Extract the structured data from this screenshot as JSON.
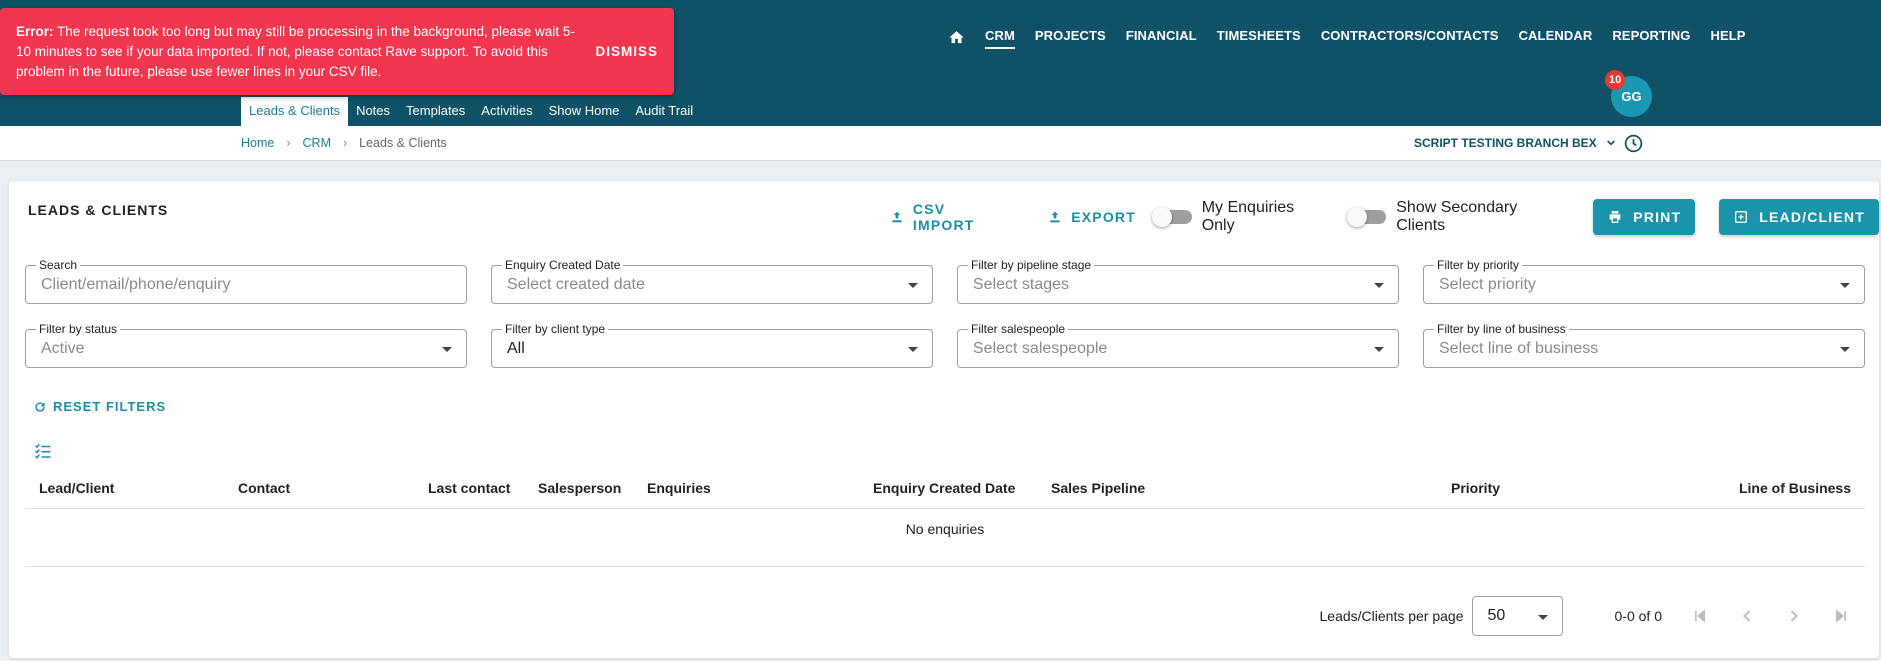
{
  "nav": {
    "items": [
      "CRM",
      "PROJECTS",
      "FINANCIAL",
      "TIMESHEETS",
      "CONTRACTORS/CONTACTS",
      "CALENDAR",
      "REPORTING",
      "HELP"
    ],
    "active": "CRM"
  },
  "user": {
    "initials": "GG",
    "notifications": "10"
  },
  "subnav": [
    "Leads & Clients",
    "Notes",
    "Templates",
    "Activities",
    "Show Home",
    "Audit Trail"
  ],
  "breadcrumb": {
    "home": "Home",
    "crm": "CRM",
    "current": "Leads & Clients"
  },
  "branch": "SCRIPT TESTING BRANCH BEX",
  "toast": {
    "prefix": "Error:",
    "message": " The request took too long but may still be processing in the background, please wait 5-10 minutes to see if your data imported. If not, please contact Rave support. To avoid this problem in the future, please use fewer lines in your CSV file.",
    "dismiss": "DISMISS"
  },
  "page": {
    "title": "LEADS & CLIENTS",
    "csv_import": "CSV IMPORT",
    "export": "EXPORT",
    "my_enquiries": "My Enquiries Only",
    "secondary_clients": "Show Secondary Clients",
    "print": "PRINT",
    "add": "LEAD/CLIENT",
    "reset": "RESET FILTERS"
  },
  "filters": {
    "search": {
      "label": "Search",
      "placeholder": "Client/email/phone/enquiry"
    },
    "created": {
      "label": "Enquiry Created Date",
      "placeholder": "Select created date"
    },
    "pipeline": {
      "label": "Filter by pipeline stage",
      "placeholder": "Select stages"
    },
    "priority": {
      "label": "Filter by priority",
      "placeholder": "Select priority"
    },
    "status": {
      "label": "Filter by status",
      "placeholder": "Active"
    },
    "client_type": {
      "label": "Filter by client type",
      "value": "All"
    },
    "salespeople": {
      "label": "Filter salespeople",
      "placeholder": "Select salespeople"
    },
    "lob": {
      "label": "Filter by line of business",
      "placeholder": "Select line of business"
    }
  },
  "table": {
    "headers": [
      "Lead/Client",
      "Contact",
      "Last contact",
      "Salesperson",
      "Enquiries",
      "Enquiry Created Date",
      "Sales Pipeline",
      "Priority",
      "Line of Business"
    ],
    "empty": "No enquiries"
  },
  "pagination": {
    "label": "Leads/Clients per page",
    "per_page": "50",
    "range": "0-0 of 0"
  },
  "colors": {
    "header": "#0f5268",
    "accent": "#1a94ab",
    "error": "#f2364f"
  }
}
